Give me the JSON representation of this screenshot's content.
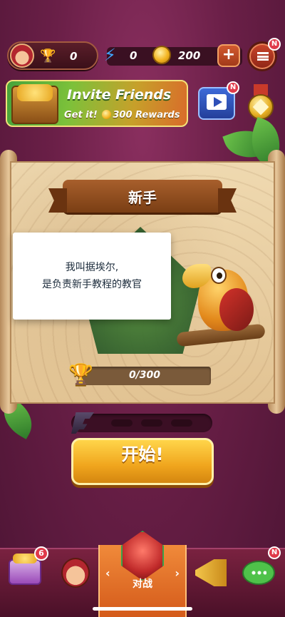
{
  "top_bar": {
    "trophies": "0",
    "energy": "0",
    "coins": "200",
    "plus_label": "+",
    "menu_badge": "N"
  },
  "invite_banner": {
    "title": "Invite Friends",
    "sub_prefix": "Get it!",
    "reward_amount": "300",
    "reward_suffix": "Rewards"
  },
  "video_badge": "N",
  "level": {
    "name": "新手",
    "progress_text": "0/300",
    "progress": 0.0
  },
  "dialog": {
    "line1": "我叫据埃尔,",
    "line2": "是负责新手教程的教官"
  },
  "start_button": "开始!",
  "bottom_nav": {
    "shop_badge": "6",
    "battle_label": "对战",
    "chat_badge": "N",
    "left_arrow": "‹",
    "right_arrow": "›"
  },
  "colors": {
    "background": "#6a1f47",
    "start_button": "#f0a51d",
    "parchment": "#e8cfa4",
    "badge": "#e03a4a"
  }
}
